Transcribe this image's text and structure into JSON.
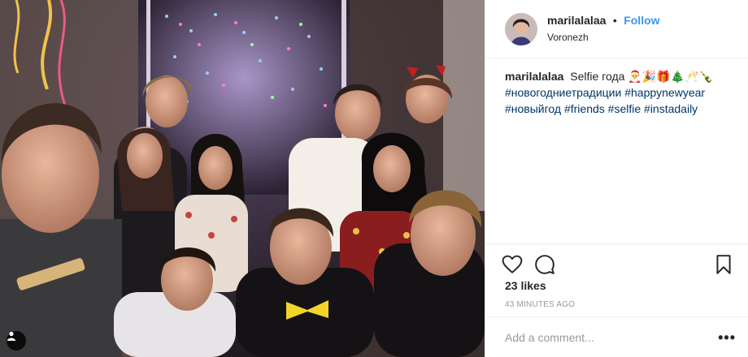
{
  "post": {
    "photo_icon": "person-tag-icon"
  },
  "header": {
    "username": "marilalalaa",
    "separator": "•",
    "follow_label": "Follow",
    "location": "Voronezh"
  },
  "caption": {
    "username": "marilalalaa",
    "text": "Selfie года",
    "emojis": "🎅🎉🎁🎄🥂🍾",
    "hashtags_line1": [
      "#новогодниетрадиции",
      "#happynewyear"
    ],
    "hashtags_line2": [
      "#новыйгод",
      "#friends",
      "#selfie",
      "#instadaily"
    ]
  },
  "actions": {
    "like_icon": "heart-icon",
    "comment_icon": "comment-icon",
    "save_icon": "bookmark-icon"
  },
  "likes": "23 likes",
  "time": "43 MINUTES AGO",
  "comment": {
    "placeholder": "Add a comment...",
    "more_label": "•••"
  },
  "colors": {
    "accent": "#3897f0",
    "hashtag": "#003569",
    "muted": "#999999",
    "border": "#efefef"
  }
}
